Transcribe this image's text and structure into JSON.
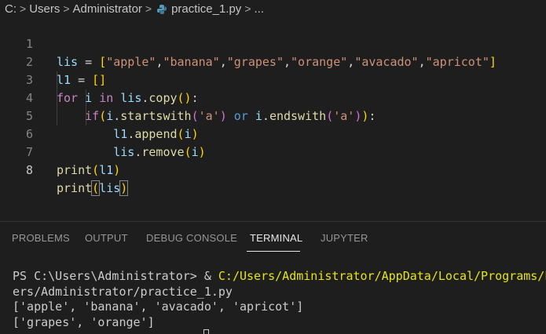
{
  "breadcrumb": {
    "items": [
      "C:",
      "Users",
      "Administrator",
      "practice_1.py",
      "..."
    ],
    "separator": ">"
  },
  "editor": {
    "active_line": 8,
    "line_numbers": [
      "1",
      "2",
      "3",
      "4",
      "5",
      "6",
      "7",
      "8"
    ]
  },
  "panel": {
    "tabs": [
      "PROBLEMS",
      "OUTPUT",
      "DEBUG CONSOLE",
      "TERMINAL",
      "JUPYTER"
    ],
    "active_tab": "TERMINAL"
  },
  "terminal": {
    "prompt": "PS C:\\Users\\Administrator> & ",
    "command": "C:/Users/Administrator/AppData/Local/Programs/P",
    "wrap": "ers/Administrator/practice_1.py",
    "output": [
      "['apple', 'banana', 'avacado', 'apricot']",
      "['grapes', 'orange']"
    ]
  },
  "colors": {
    "background": "#1e1e1e",
    "keyword": "#c586c0",
    "string": "#ce9178",
    "variable": "#9cdcfe",
    "function": "#dcdcaa",
    "command_yellow": "#e5e510"
  },
  "icons": {
    "file": "python-file-icon"
  }
}
